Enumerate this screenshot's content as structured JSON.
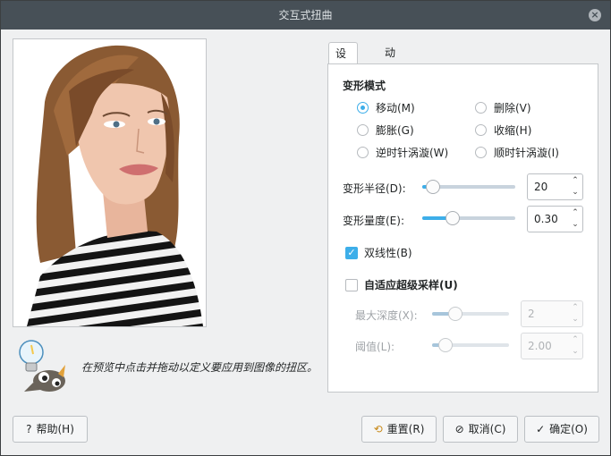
{
  "window": {
    "title": "交互式扭曲"
  },
  "hint": {
    "text": "在预览中点击并拖动以定义要应用到图像的扭区。"
  },
  "tabs": [
    {
      "label": "设置(S)"
    },
    {
      "label": "动画(A)"
    }
  ],
  "settings": {
    "mode_title": "变形模式",
    "modes": [
      {
        "label": "移动(M)",
        "checked": true
      },
      {
        "label": "删除(V)",
        "checked": false
      },
      {
        "label": "膨胀(G)",
        "checked": false
      },
      {
        "label": "收缩(H)",
        "checked": false
      },
      {
        "label": "逆时针涡漩(W)",
        "checked": false
      },
      {
        "label": "顺时针涡漩(I)",
        "checked": false
      }
    ],
    "radius": {
      "label": "变形半径(D):",
      "value": "20",
      "fraction": 0.04
    },
    "amount": {
      "label": "变形量度(E):",
      "value": "0.30",
      "fraction": 0.3
    },
    "bilinear": {
      "label": "双线性(B)",
      "checked": true
    },
    "adaptive": {
      "label": "自适应超级采样(U)",
      "checked": false
    },
    "max_depth": {
      "label": "最大深度(X):",
      "value": "2",
      "fraction": 0.25
    },
    "threshold": {
      "label": "阈值(L):",
      "value": "2.00",
      "fraction": 0.1
    }
  },
  "buttons": {
    "help": "帮助(H)",
    "reset": "重置(R)",
    "cancel": "取消(C)",
    "ok": "确定(O)"
  },
  "icons": {
    "help": "question-icon",
    "reset": "reset-icon",
    "cancel": "cancel-icon",
    "ok": "check-icon"
  },
  "colors": {
    "accent": "#3daee9",
    "titlebar": "#475057"
  }
}
